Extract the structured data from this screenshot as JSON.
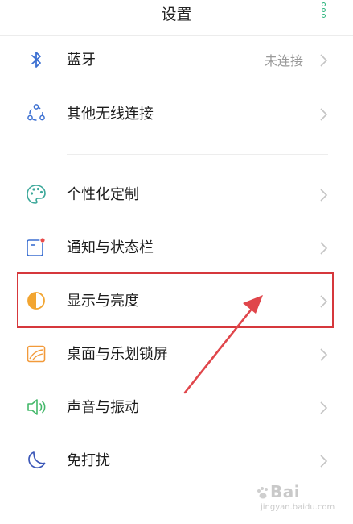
{
  "header": {
    "title": "设置"
  },
  "items": [
    {
      "label": "蓝牙",
      "value": "未连接",
      "icon": "bluetooth-icon"
    },
    {
      "label": "其他无线连接",
      "icon": "wireless-connection-icon"
    },
    {
      "label": "个性化定制",
      "icon": "palette-icon"
    },
    {
      "label": "通知与状态栏",
      "icon": "notification-icon"
    },
    {
      "label": "显示与亮度",
      "icon": "brightness-icon"
    },
    {
      "label": "桌面与乐划锁屏",
      "icon": "wallpaper-icon"
    },
    {
      "label": "声音与振动",
      "icon": "speaker-icon"
    },
    {
      "label": "免打扰",
      "icon": "moon-icon"
    }
  ],
  "watermark": {
    "brand": "Bai",
    "url": "jingyan.baidu.com"
  },
  "colors": {
    "accent_green": "#2fb57f",
    "icon_blue": "#3b6fd1",
    "highlight_red": "#d6383c",
    "arrow_red": "#e0464b",
    "notification_red": "#e84a4a",
    "brightness_orange": "#f2a531",
    "wallpaper_orange": "#f29a3a",
    "sound_green": "#44b86a",
    "moon_indigo": "#3c58b8",
    "palette_teal": "#3ca89a"
  }
}
